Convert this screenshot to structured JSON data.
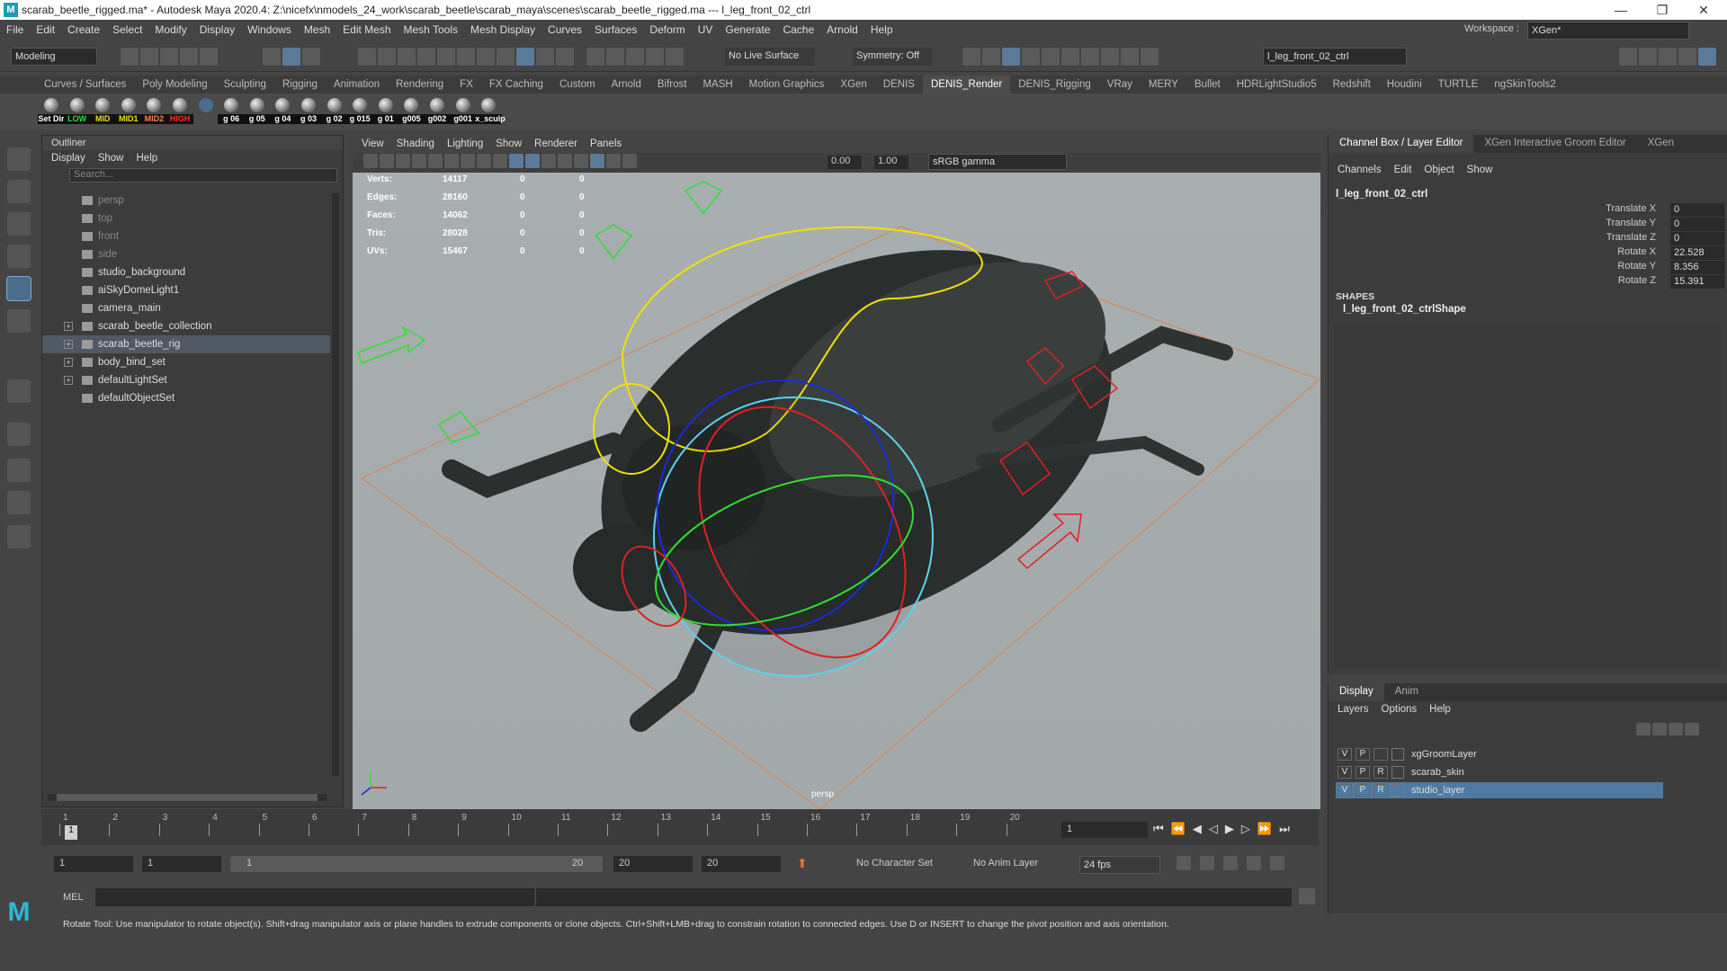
{
  "titlebar": {
    "title": "scarab_beetle_rigged.ma* - Autodesk Maya 2020.4: Z:\\nicefx\\nmodels_24_work\\scarab_beetle\\scarab_maya\\scenes\\scarab_beetle_rigged.ma  ---  l_leg_front_02_ctrl",
    "minimize": "—",
    "restore": "❐",
    "close": "✕"
  },
  "menubar": [
    "File",
    "Edit",
    "Create",
    "Select",
    "Modify",
    "Display",
    "Windows",
    "Mesh",
    "Edit Mesh",
    "Mesh Tools",
    "Mesh Display",
    "Curves",
    "Surfaces",
    "Deform",
    "UV",
    "Generate",
    "Cache",
    "Arnold",
    "Help"
  ],
  "workspace": {
    "label": "Workspace :",
    "value": "XGen*"
  },
  "statusline": {
    "menuset": "Modeling",
    "live_surface": "No Live Surface",
    "symmetry": "Symmetry: Off",
    "selected_field": "l_leg_front_02_ctrl"
  },
  "shelf_tabs": [
    "Curves / Surfaces",
    "Poly Modeling",
    "Sculpting",
    "Rigging",
    "Animation",
    "Rendering",
    "FX",
    "FX Caching",
    "Custom",
    "Arnold",
    "Bifrost",
    "MASH",
    "Motion Graphics",
    "XGen",
    "DENIS",
    "DENIS_Render",
    "DENIS_Rigging",
    "VRay",
    "MERY",
    "Bullet",
    "HDRLightStudio5",
    "Redshift",
    "Houdini",
    "TURTLE",
    "ngSkinTools2"
  ],
  "shelf_active": "DENIS_Render",
  "shelf_buttons": [
    "Set Dir",
    "LOW",
    "MID",
    "MID1",
    "MID2",
    "HIGH",
    "",
    "g 06",
    "g 05",
    "g 04",
    "g 03",
    "g 02",
    "g 015",
    "g 01",
    "g005",
    "g002",
    "g001",
    "x_sculp"
  ],
  "outliner": {
    "title": "Outliner",
    "menu": [
      "Display",
      "Show",
      "Help"
    ],
    "search_placeholder": "Search...",
    "items": [
      {
        "label": "persp",
        "dim": true
      },
      {
        "label": "top",
        "dim": true
      },
      {
        "label": "front",
        "dim": true
      },
      {
        "label": "side",
        "dim": true
      },
      {
        "label": "studio_background"
      },
      {
        "label": "aiSkyDomeLight1"
      },
      {
        "label": "camera_main"
      },
      {
        "label": "scarab_beetle_collection",
        "expand": "+"
      },
      {
        "label": "scarab_beetle_rig",
        "expand": "+",
        "selected": true
      },
      {
        "label": "body_bind_set",
        "expand": "+"
      },
      {
        "label": "defaultLightSet",
        "expand": "+"
      },
      {
        "label": "defaultObjectSet"
      }
    ]
  },
  "viewport": {
    "menu": [
      "View",
      "Shading",
      "Lighting",
      "Show",
      "Renderer",
      "Panels"
    ],
    "near": "0.00",
    "far": "1.00",
    "colorspace": "sRGB gamma",
    "camera_label": "persp",
    "hud": [
      {
        "label": "Verts:",
        "v": "14117",
        "a": "0",
        "b": "0"
      },
      {
        "label": "Edges:",
        "v": "28160",
        "a": "0",
        "b": "0"
      },
      {
        "label": "Faces:",
        "v": "14062",
        "a": "0",
        "b": "0"
      },
      {
        "label": "Tris:",
        "v": "28028",
        "a": "0",
        "b": "0"
      },
      {
        "label": "UVs:",
        "v": "15467",
        "a": "0",
        "b": "0"
      }
    ]
  },
  "channelbox": {
    "tabs": [
      "Channel Box / Layer Editor",
      "XGen Interactive Groom Editor",
      "XGen"
    ],
    "menu": [
      "Channels",
      "Edit",
      "Object",
      "Show"
    ],
    "object": "l_leg_front_02_ctrl",
    "attrs": [
      {
        "name": "Translate X",
        "value": "0"
      },
      {
        "name": "Translate Y",
        "value": "0"
      },
      {
        "name": "Translate Z",
        "value": "0"
      },
      {
        "name": "Rotate X",
        "value": "22.528"
      },
      {
        "name": "Rotate Y",
        "value": "8.356"
      },
      {
        "name": "Rotate Z",
        "value": "15.391"
      }
    ],
    "shapes_label": "SHAPES",
    "shape": "l_leg_front_02_ctrlShape"
  },
  "layer_editor": {
    "tabs": [
      "Display",
      "Anim"
    ],
    "menu": [
      "Layers",
      "Options",
      "Help"
    ],
    "layers": [
      {
        "v": "V",
        "p": "P",
        "r": "",
        "name": "xgGroomLayer"
      },
      {
        "v": "V",
        "p": "P",
        "r": "R",
        "name": "scarab_skin"
      },
      {
        "v": "V",
        "p": "P",
        "r": "R",
        "name": "studio_layer",
        "selected": true
      }
    ]
  },
  "timeline": {
    "ticks": [
      "1",
      "2",
      "3",
      "4",
      "5",
      "6",
      "7",
      "8",
      "9",
      "10",
      "11",
      "12",
      "13",
      "14",
      "15",
      "16",
      "17",
      "18",
      "19",
      "20"
    ],
    "current_frame": "1",
    "current_frame_marker": "1"
  },
  "range": {
    "start": "1",
    "playback_start": "1",
    "slider_start": "1",
    "slider_end": "20",
    "playback_end": "20",
    "end": "20",
    "character_set": "No Character Set",
    "anim_layer": "No Anim Layer",
    "fps": "24 fps"
  },
  "cmdline": {
    "label": "MEL"
  },
  "helpline": "Rotate Tool: Use manipulator to rotate object(s). Shift+drag manipulator axis or plane handles to extrude components or clone objects. Ctrl+Shift+LMB+drag to constrain rotation to connected edges. Use D or INSERT to change the pivot position and axis orientation.",
  "colors": {
    "selection": "#4f7aa1",
    "viewport_bg": "#a6adae",
    "ctrl_yellow": "#f0e000",
    "ctrl_green": "#2ee02e",
    "ctrl_red": "#e02020",
    "ctrl_cyan": "#5fd0f0"
  }
}
